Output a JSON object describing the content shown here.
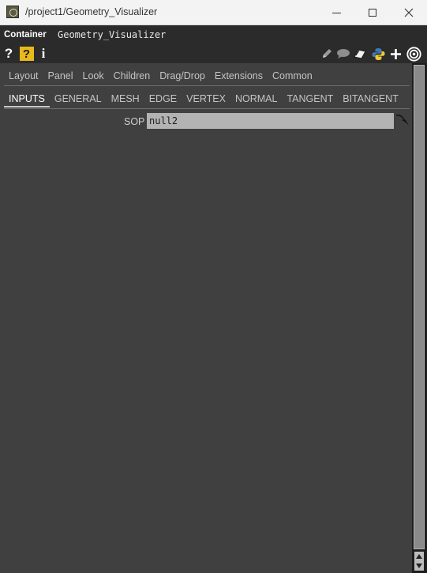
{
  "window": {
    "title": "/project1/Geometry_Visualizer",
    "minimize_icon": "minimize-icon",
    "maximize_icon": "maximize-icon",
    "close_icon": "close-icon"
  },
  "operator": {
    "type": "Container",
    "name": "Geometry_Visualizer"
  },
  "toolbar": {
    "left_icons": [
      "help-icon",
      "op-help-icon",
      "info-icon"
    ],
    "right_icons": [
      "edit-icon",
      "comment-icon",
      "clone-icon",
      "python-icon",
      "add-icon",
      "target-icon"
    ],
    "help_glyph": "?",
    "op_help_glyph": "?",
    "info_glyph": "i"
  },
  "page_tabs": [
    "Layout",
    "Panel",
    "Look",
    "Children",
    "Drag/Drop",
    "Extensions",
    "Common"
  ],
  "param_tabs": [
    "INPUTS",
    "GENERAL",
    "MESH",
    "EDGE",
    "VERTEX",
    "NORMAL",
    "TANGENT",
    "BITANGENT"
  ],
  "active_param_tab": "INPUTS",
  "params": {
    "sop": {
      "label": "SOP",
      "value": "null2"
    }
  },
  "colors": {
    "background": "#404040",
    "header": "#2b2b2b",
    "field": "#b3b3b3",
    "titlebar": "#f3f3f3"
  }
}
